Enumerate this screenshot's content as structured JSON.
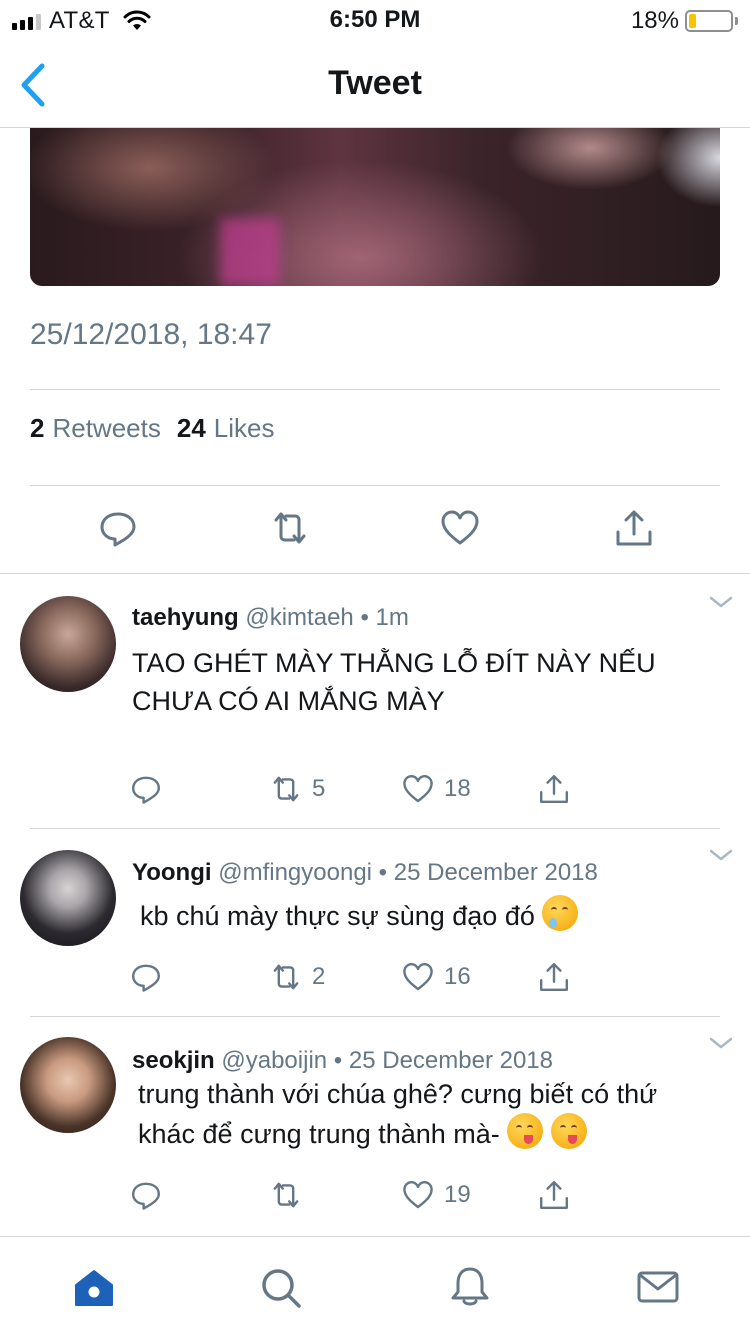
{
  "status_bar": {
    "carrier": "AT&T",
    "time": "6:50 PM",
    "battery_percent": "18%",
    "battery_level": 0.18,
    "battery_color": "#f7c500",
    "signal_bars": 3,
    "icons": [
      "signal-bars-icon",
      "wifi-icon",
      "battery-icon"
    ]
  },
  "nav": {
    "title": "Tweet",
    "back_icon": "chevron-left-icon",
    "accent_color": "#1da1f2"
  },
  "tweet": {
    "timestamp": "25/12/2018, 18:47",
    "retweets_count": "2",
    "retweets_label": "Retweets",
    "likes_count": "24",
    "likes_label": "Likes",
    "actions": [
      "reply-icon",
      "retweet-icon",
      "like-icon",
      "share-icon"
    ]
  },
  "replies": [
    {
      "name": "taehyung",
      "handle": "@kimtaeh",
      "separator": "•",
      "time": "1m",
      "text": "TAO GHÉT MÀY THẰNG LỖ ĐÍT NÀY NẾU CHƯA CÓ AI MẮNG MÀY",
      "retweets": "5",
      "likes": "18"
    },
    {
      "name": "Yoongi",
      "handle": "@mfingyoongi",
      "separator": "•",
      "time": "25 December 2018",
      "text": "kb chú mày thực sự sùng đạo đó",
      "emoji": "drooling-face-emoji",
      "retweets": "2",
      "likes": "16"
    },
    {
      "name": "seokjin",
      "handle": "@yaboijin",
      "separator": "•",
      "time": "25 December 2018",
      "text": "trung thành với chúa ghê? cưng biết có thứ khác để cưng trung thành mà-",
      "emoji": "yum-face-emoji",
      "retweets": "",
      "likes": "19"
    }
  ],
  "tab_bar": {
    "items": [
      "home-icon",
      "search-icon",
      "notifications-icon",
      "messages-icon"
    ],
    "active": "home-icon",
    "active_color": "#1d62b8",
    "inactive_color": "#657786"
  }
}
